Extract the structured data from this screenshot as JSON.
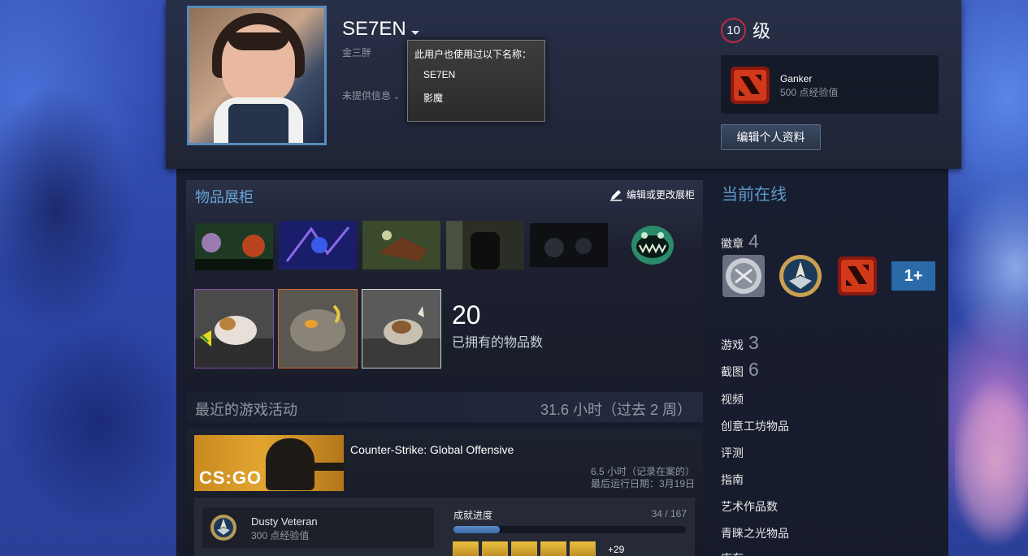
{
  "profile": {
    "persona_name": "SE7EN",
    "real_name": "金三胖",
    "no_info": "未提供信息",
    "aliases_title": "此用户也使用过以下名称：",
    "aliases": [
      "SE7EN",
      "影魔"
    ],
    "level": "10",
    "level_suffix": "级",
    "favorite_badge": {
      "name": "Ganker",
      "xp": "500 点经验值"
    },
    "edit_button": "编辑个人资料"
  },
  "showcase": {
    "title": "物品展柜",
    "edit_label": "编辑或更改展柜",
    "item_count": "20",
    "item_count_label": "已拥有的物品数"
  },
  "sidebar": {
    "online_status": "当前在线",
    "badges_label": "徽章",
    "badges_count": "4",
    "more_badges": "1+",
    "games_label": "游戏",
    "games_count": "3",
    "screenshots_label": "截图",
    "screenshots_count": "6",
    "links": [
      "视频",
      "创意工坊物品",
      "评测",
      "指南",
      "艺术作品数",
      "青睐之光物品",
      "库存"
    ]
  },
  "recent": {
    "title": "最近的游戏活动",
    "hours": "31.6 小时（过去 2 周）",
    "game": {
      "logo_text": "CS:GO",
      "name": "Counter-Strike: Global Offensive",
      "hours_on_record": "6.5 小时（记录在案的）",
      "last_played": "最后运行日期：3月19日",
      "badge_name": "Dusty Veteran",
      "badge_xp": "300 点经验值",
      "achievement_title": "成就进度",
      "achievement_count": "34 / 167",
      "achievement_progress": 0.2,
      "more_achievements": "+29"
    }
  },
  "colors": {
    "accent_blue": "#66a4d6",
    "level_ring": "#c02942",
    "page_bg": "#1a1d29"
  }
}
